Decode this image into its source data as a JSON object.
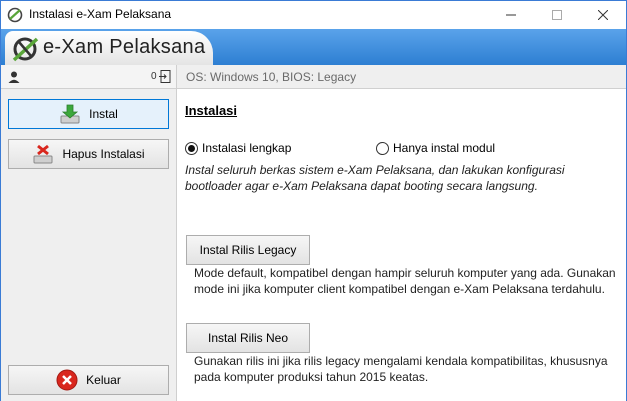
{
  "window": {
    "title": "Instalasi e-Xam Pelaksana"
  },
  "header": {
    "brand": "e-Xam Pelaksana"
  },
  "sidebar": {
    "count": "0",
    "items": [
      {
        "label": "Instal",
        "icon": "install-icon",
        "active": true
      },
      {
        "label": "Hapus Instalasi",
        "icon": "uninstall-icon",
        "active": false
      }
    ],
    "exit_label": "Keluar"
  },
  "main": {
    "system_info": "OS: Windows 10, BIOS: Legacy",
    "section_title": "Instalasi",
    "options": [
      {
        "label": "Instalasi lengkap",
        "selected": true
      },
      {
        "label": "Hanya instal modul",
        "selected": false
      }
    ],
    "description": "Instal seluruh berkas sistem e-Xam Pelaksana, dan lakukan konfigurasi bootloader agar e-Xam Pelaksana dapat booting secara langsung.",
    "legacy": {
      "button": "Instal Rilis Legacy",
      "note": "Mode default, kompatibel dengan hampir seluruh komputer yang ada. Gunakan mode ini jika komputer client kompatibel dengan e-Xam Pelaksana terdahulu."
    },
    "neo": {
      "button": "Instal Rilis Neo",
      "note": "Gunakan rilis ini jika rilis legacy mengalami kendala kompatibilitas, khususnya pada komputer produksi tahun 2015 keatas."
    }
  },
  "colors": {
    "banner": "#3a8ee0",
    "active_border": "#0078d7",
    "exit_red": "#d9271e",
    "install_green": "#3ca83c"
  }
}
